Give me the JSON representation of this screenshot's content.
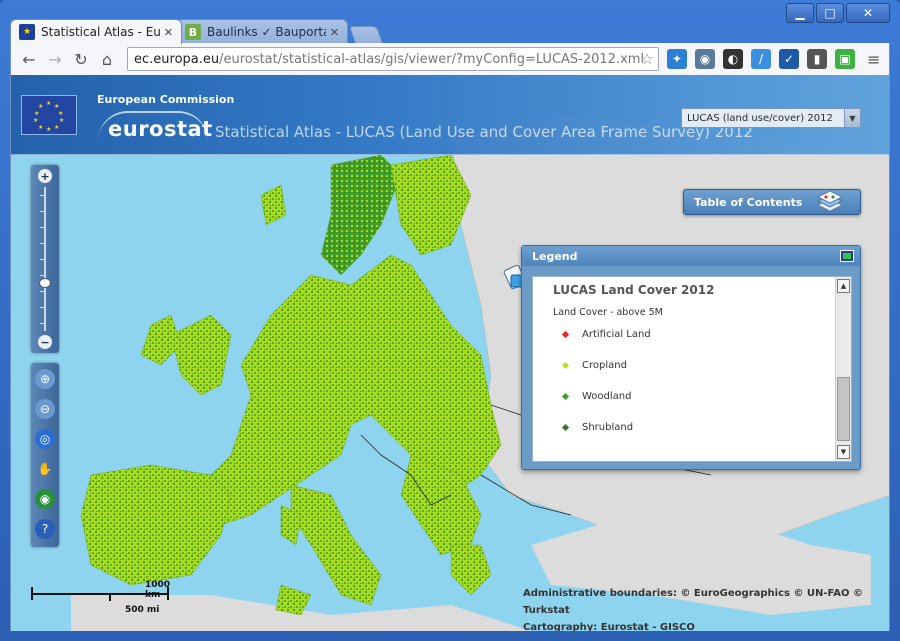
{
  "browser": {
    "tabs": [
      {
        "label": "Statistical Atlas - Eurost",
        "active": true
      },
      {
        "label": "Baulinks ✓ Bauportal",
        "active": false
      }
    ],
    "address": {
      "host": "ec.europa.eu",
      "path": "/eurostat/statistical-atlas/gis/viewer/?myConfig=LUCAS-2012.xml"
    },
    "window_controls": [
      "minimize",
      "maximize",
      "close"
    ]
  },
  "header": {
    "organisation": "European Commission",
    "logo_text": "eurostat",
    "title": "Statistical Atlas - LUCAS (Land Use and Cover Area Frame Survey) 2012",
    "layer_selector": "LUCAS (land use/cover) 2012"
  },
  "toc": {
    "label": "Table of Contents"
  },
  "legend": {
    "header": "Legend",
    "title": "LUCAS Land Cover 2012",
    "subtitle": "Land Cover - above 5M",
    "items": [
      {
        "label": "Artificial Land",
        "color": "#e8231f"
      },
      {
        "label": "Cropland",
        "color": "#b6e61a"
      },
      {
        "label": "Woodland",
        "color": "#3f9c2a"
      },
      {
        "label": "Shrubland",
        "color": "#2f7a1c"
      }
    ]
  },
  "scale": {
    "km": "1000 km",
    "mi": "500 mi"
  },
  "attribution": {
    "line1": "Administrative boundaries: © EuroGeographics © UN-FAO © Turkstat",
    "line2": "Cartography: Eurostat - GISCO"
  },
  "colors": {
    "sea": "#8ed4ee",
    "land_gray": "#dcdcdc",
    "cropland": "#b6e61a",
    "woodland": "#3f9c2a",
    "artificial": "#e8231f"
  }
}
